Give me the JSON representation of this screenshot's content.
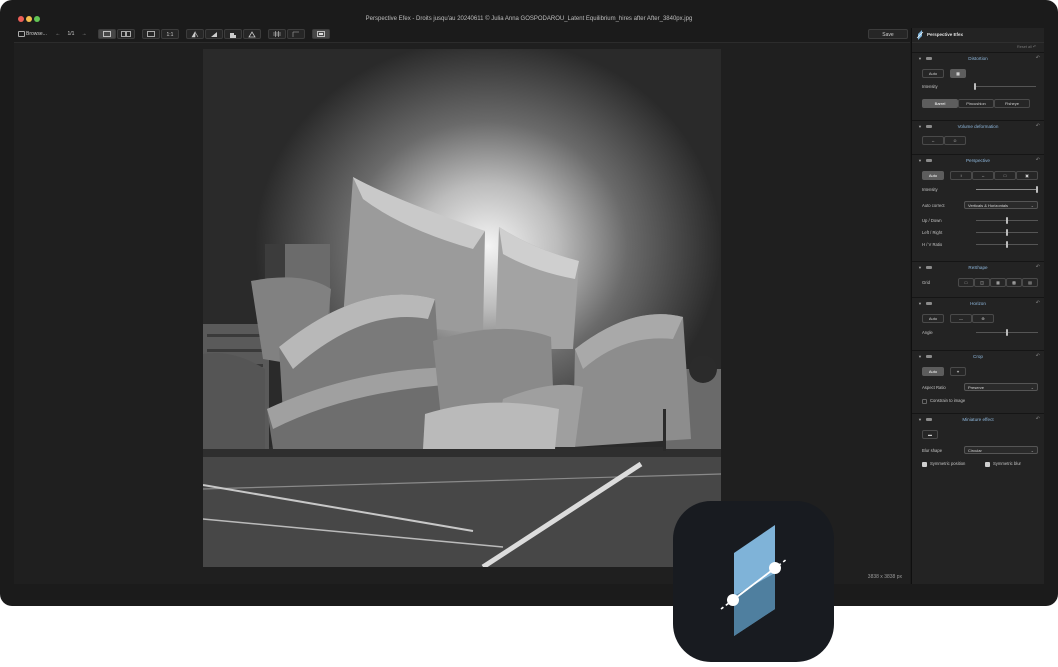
{
  "window": {
    "title": "Perspective Efex - Droits jusqu'au 20240611 © Julia Anna GOSPODAROU_Latent Equilibrium_hires after After_3840px.jpg"
  },
  "toolbar": {
    "browse_label": "Browse...",
    "counter": "1/1",
    "zoom_label": "1:1",
    "save_label": "Save"
  },
  "canvas": {
    "dimensions": "3838 x 3838 px"
  },
  "panel": {
    "title": "Perspective Efex",
    "reset_all": "Reset all",
    "distortion": {
      "name": "Distortion",
      "auto": "Auto",
      "intensity_label": "Intensity",
      "intensity": 0.02,
      "modes": [
        "Barrel",
        "Pincushion",
        "Fisheye"
      ],
      "selected_mode": "Barrel"
    },
    "volume": {
      "name": "Volume deformation"
    },
    "perspective": {
      "name": "Perspective",
      "auto": "Auto",
      "intensity_label": "Intensity",
      "intensity": 1.0,
      "autocorrect_label": "Auto correct",
      "autocorrect_value": "Verticals & Horizontals",
      "updown_label": "Up / Down",
      "leftright_label": "Left / Right",
      "hvratio_label": "H / V Ratio"
    },
    "reshape": {
      "name": "ReShape",
      "grid_label": "Grid"
    },
    "horizon": {
      "name": "Horizon",
      "auto": "Auto",
      "angle_label": "Angle"
    },
    "crop": {
      "name": "Crop",
      "auto": "Auto",
      "aspect_label": "Aspect Ratio",
      "aspect_value": "Preserve",
      "constrain_label": "Constrain to image"
    },
    "miniature": {
      "name": "Miniature effect",
      "blur_label": "Blur shape",
      "blur_value": "Circular",
      "sym_position": "Symmetric position",
      "sym_blur": "Symmetric blur"
    }
  },
  "colors": {
    "accent_section": "#8fb8dd",
    "app_icon_bg": "#181b20",
    "app_icon_blue": "#7fb3d8"
  }
}
